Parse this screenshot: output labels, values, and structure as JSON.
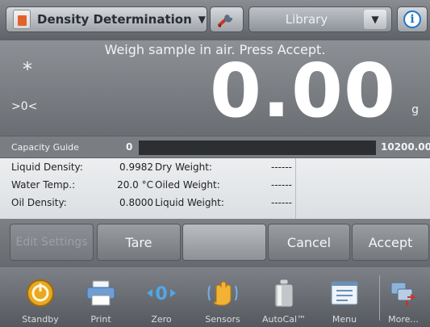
{
  "topbar": {
    "app_title": "Density Determination",
    "app_icon": "density-app-icon",
    "tools_icon": "wrench-icon",
    "library_label": "Library",
    "info_icon": "info-icon",
    "info_glyph": "i"
  },
  "display": {
    "instruction": "Weigh sample in air. Press Accept.",
    "stable_indicator": "*",
    "center_zero_indicator": ">0<",
    "weight_value": "0.00",
    "unit": "g"
  },
  "capacity_guide": {
    "label": "Capacity Guide",
    "min": "0",
    "max": "10200.00",
    "fill_fraction": 0,
    "bar_color": "#2c2e31"
  },
  "info": {
    "rows": [
      {
        "label": "Liquid Density:",
        "value": "0.9982",
        "label2": "Dry Weight:",
        "value2": "------"
      },
      {
        "label": "Water Temp.:",
        "value": "20.0 °C",
        "label2": "Oiled Weight:",
        "value2": "------"
      },
      {
        "label": "Oil Density:",
        "value": "0.8000",
        "label2": "Liquid Weight:",
        "value2": "------"
      }
    ]
  },
  "actions": {
    "edit_settings": "Edit Settings",
    "tare": "Tare",
    "cancel": "Cancel",
    "accept": "Accept"
  },
  "nav": {
    "items": [
      {
        "label": "Standby",
        "icon": "standby-icon"
      },
      {
        "label": "Print",
        "icon": "printer-icon"
      },
      {
        "label": "Zero",
        "icon": "zero-icon"
      },
      {
        "label": "Sensors",
        "icon": "hand-sensor-icon"
      },
      {
        "label": "AutoCal™",
        "icon": "calibration-weight-icon"
      },
      {
        "label": "Menu",
        "icon": "menu-icon"
      },
      {
        "label": "More...",
        "icon": "more-icon"
      }
    ]
  }
}
